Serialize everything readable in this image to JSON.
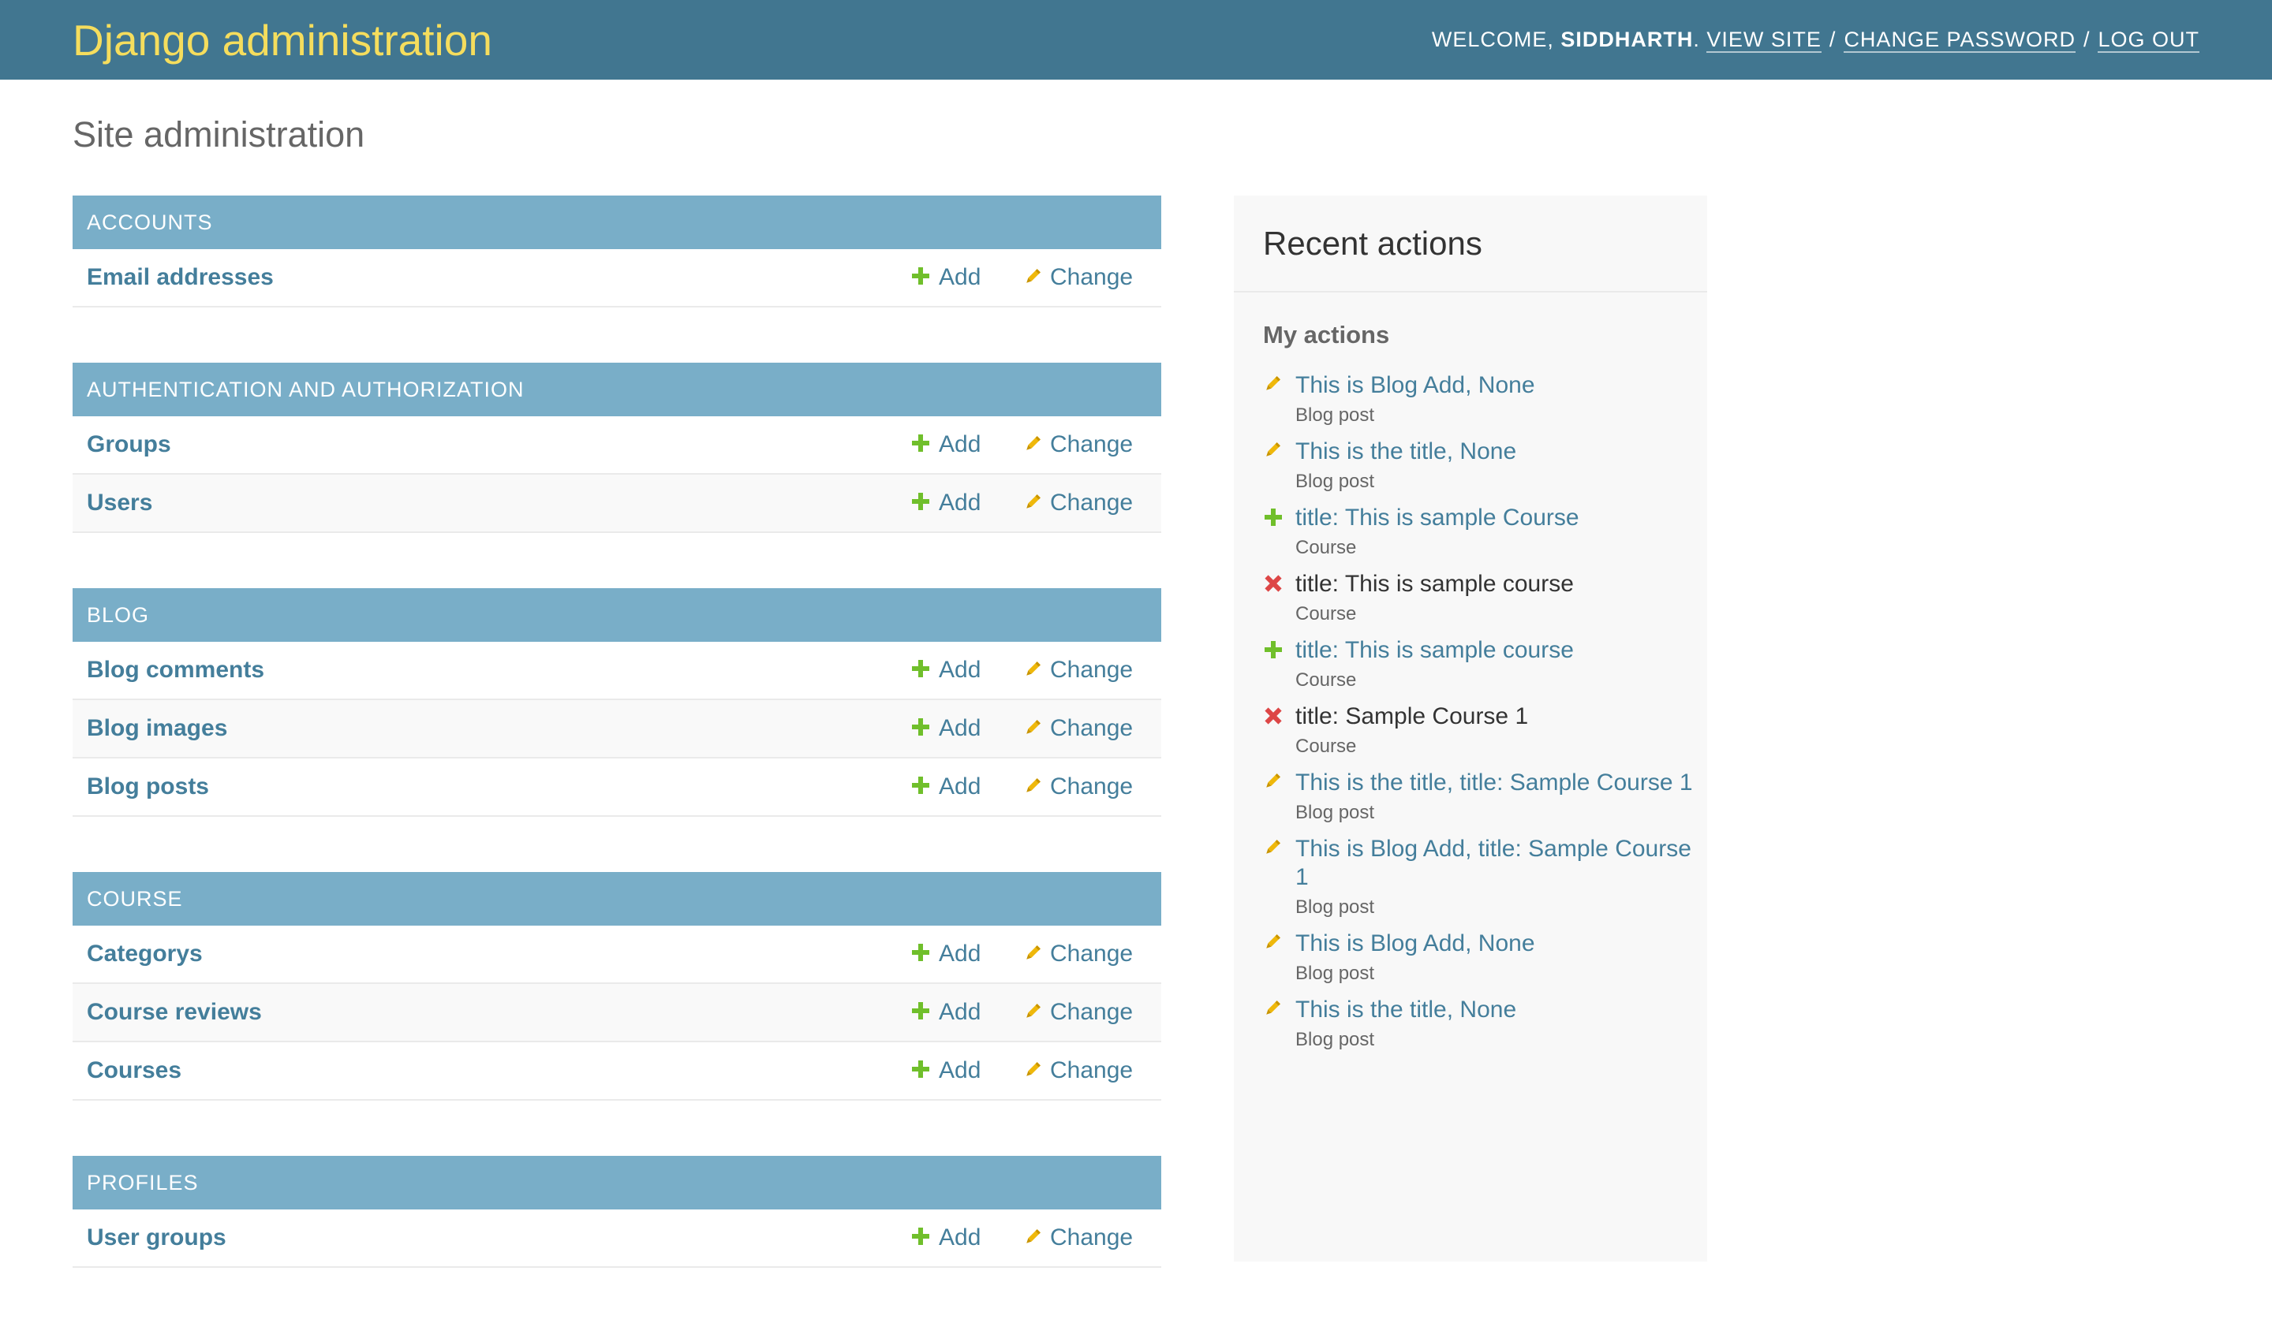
{
  "header": {
    "brand": "Django administration",
    "welcome": "WELCOME,",
    "username": "SIDDHARTH",
    "view_site": "VIEW SITE",
    "change_password": "CHANGE PASSWORD",
    "log_out": "LOG OUT"
  },
  "page_title": "Site administration",
  "modules": [
    {
      "caption": "ACCOUNTS",
      "models": [
        {
          "name": "Email addresses",
          "add": "Add",
          "change": "Change"
        }
      ]
    },
    {
      "caption": "AUTHENTICATION AND AUTHORIZATION",
      "models": [
        {
          "name": "Groups",
          "add": "Add",
          "change": "Change"
        },
        {
          "name": "Users",
          "add": "Add",
          "change": "Change"
        }
      ]
    },
    {
      "caption": "BLOG",
      "models": [
        {
          "name": "Blog comments",
          "add": "Add",
          "change": "Change"
        },
        {
          "name": "Blog images",
          "add": "Add",
          "change": "Change"
        },
        {
          "name": "Blog posts",
          "add": "Add",
          "change": "Change"
        }
      ]
    },
    {
      "caption": "COURSE",
      "models": [
        {
          "name": "Categorys",
          "add": "Add",
          "change": "Change"
        },
        {
          "name": "Course reviews",
          "add": "Add",
          "change": "Change"
        },
        {
          "name": "Courses",
          "add": "Add",
          "change": "Change"
        }
      ]
    },
    {
      "caption": "PROFILES",
      "models": [
        {
          "name": "User groups",
          "add": "Add",
          "change": "Change"
        }
      ]
    }
  ],
  "recent": {
    "title": "Recent actions",
    "my_actions": "My actions",
    "actions": [
      {
        "type": "change",
        "title": "This is Blog Add, None",
        "content_type": "Blog post"
      },
      {
        "type": "change",
        "title": "This is the title, None",
        "content_type": "Blog post"
      },
      {
        "type": "add",
        "title": "title: This is sample Course",
        "content_type": "Course"
      },
      {
        "type": "delete",
        "title": "title: This is sample course",
        "content_type": "Course"
      },
      {
        "type": "add",
        "title": "title: This is sample course",
        "content_type": "Course"
      },
      {
        "type": "delete",
        "title": "title: Sample Course 1",
        "content_type": "Course"
      },
      {
        "type": "change",
        "title": "This is the title, title: Sample Course 1",
        "content_type": "Blog post"
      },
      {
        "type": "change",
        "title": "This is Blog Add, title: Sample Course 1",
        "content_type": "Blog post"
      },
      {
        "type": "change",
        "title": "This is Blog Add, None",
        "content_type": "Blog post"
      },
      {
        "type": "change",
        "title": "This is the title, None",
        "content_type": "Blog post"
      }
    ]
  },
  "colors": {
    "header_bg": "#417690",
    "brand": "#f5dd5d",
    "caption_bg": "#79aec8",
    "link": "#447e9b",
    "add_green": "#70bf2b",
    "change_yellow": "#efb80b",
    "delete_red": "#dd4646"
  }
}
